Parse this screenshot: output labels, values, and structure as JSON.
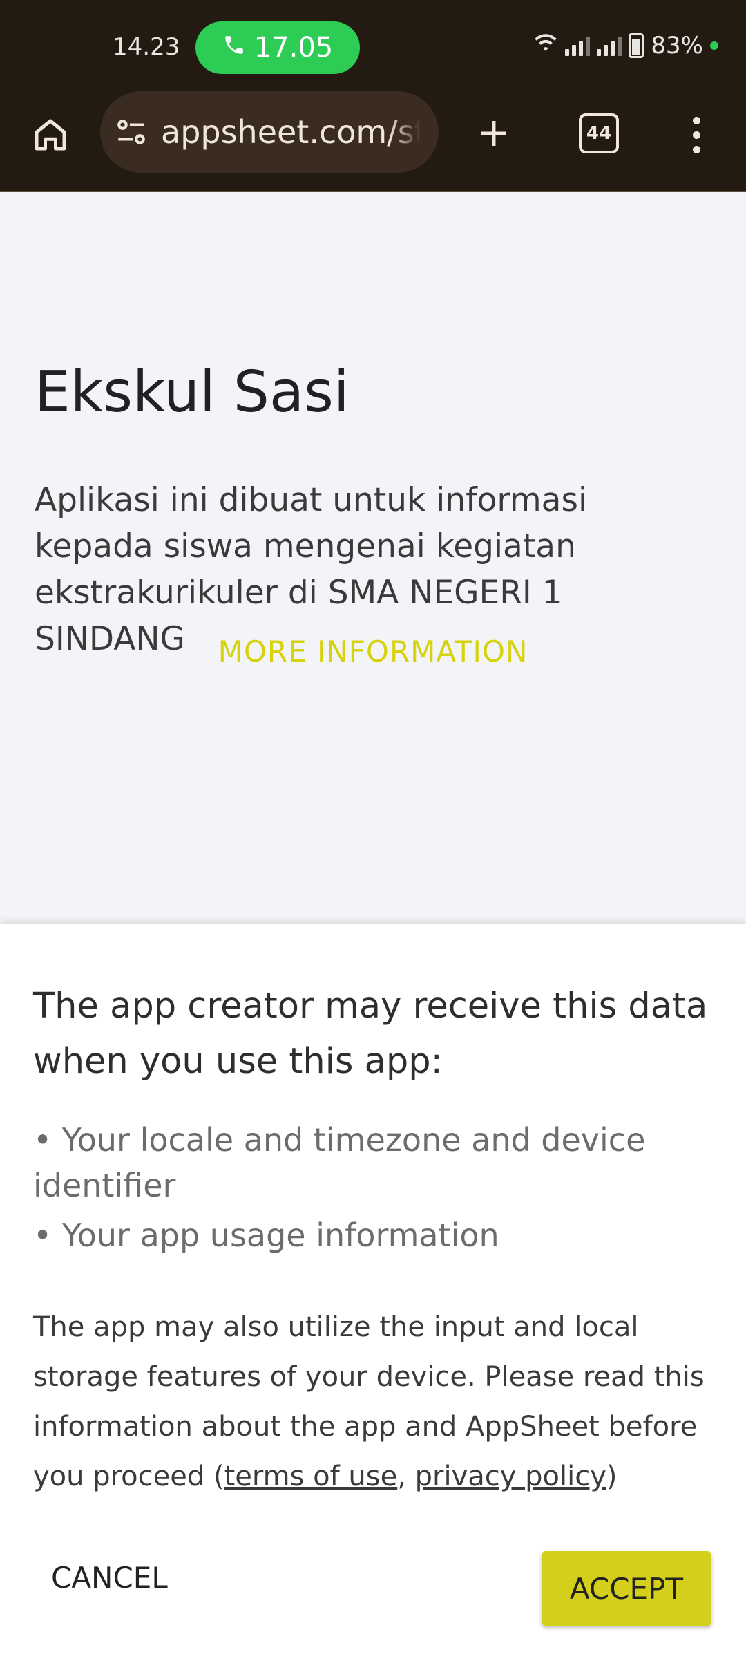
{
  "status_bar": {
    "time": "14.23",
    "call_timer": "17.05",
    "battery": "83%",
    "icons": [
      "phone-icon",
      "wifi-icon",
      "signal-icon",
      "battery-icon"
    ]
  },
  "browser": {
    "url": "appsheet.com/start",
    "tab_count": "44",
    "icons": [
      "home-icon",
      "site-settings-icon",
      "plus-icon",
      "tabs-icon",
      "more-vert-icon"
    ]
  },
  "app": {
    "title": "Ekskul Sasi",
    "description": "Aplikasi ini dibuat untuk informasi kepada siswa mengenai kegiatan ekstrakurikuler di SMA NEGERI 1 SINDANG",
    "more_info_label": "MORE INFORMATION"
  },
  "consent_sheet": {
    "heading": "The app creator may receive this data when you use this app:",
    "bullets": [
      "• Your locale and timezone and device identifier",
      "• Your app usage information"
    ],
    "note_text": "The app may also utilize the input and local storage features of your device. Please read this information about the app and AppSheet before you proceed",
    "open_paren": "(",
    "terms_link": "terms of use",
    "separator": ", ",
    "privacy_link": "privacy policy",
    "close_paren": ")",
    "cancel_label": "CANCEL",
    "accept_label": "ACCEPT"
  },
  "colors": {
    "browser_chrome": "#231a12",
    "call_pill": "#2dcc55",
    "accent": "#d4cf1a"
  }
}
